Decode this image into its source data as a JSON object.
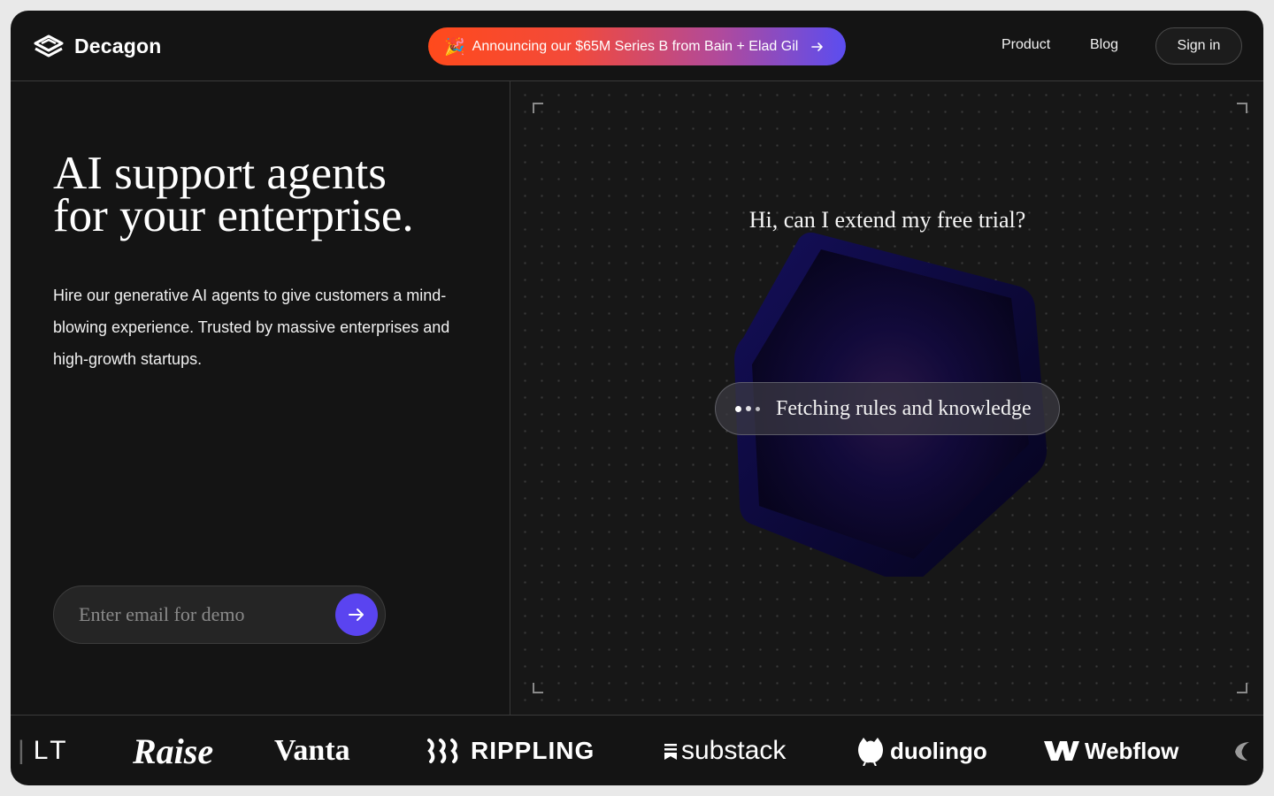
{
  "header": {
    "brand": "Decagon",
    "announcement": {
      "emoji": "🎉",
      "text": "Announcing our $65M Series B from Bain + Elad Gil"
    },
    "nav": {
      "product": "Product",
      "blog": "Blog"
    },
    "sign_in": "Sign in"
  },
  "hero": {
    "title_line1": "AI support agents",
    "title_line2": "for your enterprise.",
    "description": "Hire our generative AI agents to give customers a mind-blowing experience. Trusted by massive enterprises and high-growth startups.",
    "email_placeholder": "Enter email for demo"
  },
  "demo": {
    "question": "Hi, can I extend my free trial?",
    "status": "Fetching rules and knowledge"
  },
  "logos": {
    "partial": "LT",
    "raise": "Raise",
    "vanta": "Vanta",
    "rippling": "RIPPLING",
    "substack": "substack",
    "duolingo": "duolingo",
    "webflow": "Webflow"
  },
  "colors": {
    "background": "#141414",
    "accent": "#5a44f0",
    "announce_start": "#ff4a1c",
    "announce_end": "#5b4df0"
  }
}
